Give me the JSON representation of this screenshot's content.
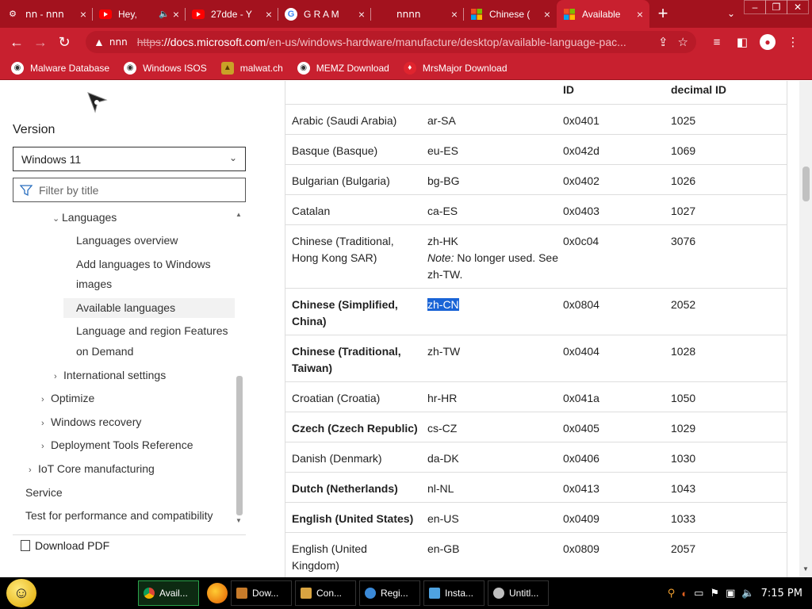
{
  "browser": {
    "tabs": [
      {
        "title": "𝗇𝗇 - 𝗇𝗇𝗇",
        "icon": "gear-icon"
      },
      {
        "title": "Hey,",
        "icon": "youtube-icon"
      },
      {
        "title": "27dde - Y",
        "icon": "youtube-icon"
      },
      {
        "title": "G R A M",
        "icon": "google-icon"
      },
      {
        "title": "𝗇𝗇𝗇𝗇",
        "icon": "blank-icon"
      },
      {
        "title": "Chinese (",
        "icon": "microsoft-icon"
      },
      {
        "title": "Available",
        "icon": "microsoft-icon"
      }
    ],
    "new_tab": "+",
    "address": {
      "site_label": "𝗇𝗇𝗇",
      "protocol": "https",
      "host": "://docs.microsoft.com",
      "path": "/en-us/windows-hardware/manufacture/desktop/available-language-pac..."
    },
    "bookmarks": [
      {
        "label": "Malware Database"
      },
      {
        "label": "Windows ISOS"
      },
      {
        "label": "malwat.ch"
      },
      {
        "label": "MEMZ Download"
      },
      {
        "label": "MrsMajor Download"
      }
    ],
    "colors": {
      "chrome": "#c8202f",
      "tabstrip": "#a3121e"
    }
  },
  "sidebar": {
    "version_label": "Version",
    "version_value": "Windows 11",
    "filter_placeholder": "Filter by title",
    "toc": [
      {
        "label": "Languages"
      },
      {
        "label": "Languages overview"
      },
      {
        "label": "Add languages to Windows"
      },
      {
        "label": "images"
      },
      {
        "label": "Available languages"
      },
      {
        "label": "Language and region Features"
      },
      {
        "label": "on Demand"
      },
      {
        "label": "International settings"
      },
      {
        "label": "Optimize"
      },
      {
        "label": "Windows recovery"
      },
      {
        "label": "Deployment Tools Reference"
      },
      {
        "label": "IoT Core manufacturing"
      },
      {
        "label": "Service"
      },
      {
        "label": "Test for performance and compatibility"
      }
    ],
    "download_pdf": "Download PDF"
  },
  "table": {
    "headers": {
      "id": "ID",
      "decimal": "decimal ID"
    },
    "rows": [
      {
        "lang": "Arabic (Saudi Arabia)",
        "tag": "ar-SA",
        "id": "0x0401",
        "dec": "1025"
      },
      {
        "lang": "Basque (Basque)",
        "tag": "eu-ES",
        "id": "0x042d",
        "dec": "1069"
      },
      {
        "lang": "Bulgarian (Bulgaria)",
        "tag": "bg-BG",
        "id": "0x0402",
        "dec": "1026"
      },
      {
        "lang": "Catalan",
        "tag": "ca-ES",
        "id": "0x0403",
        "dec": "1027"
      },
      {
        "lang": "Chinese (Traditional, Hong Kong SAR)",
        "tag": "zh-HK",
        "note_label": "Note:",
        "note": " No longer used. See zh-TW.",
        "id": "0x0c04",
        "dec": "3076"
      },
      {
        "lang": "Chinese (Simplified, China)",
        "tag": "zh-CN",
        "id": "0x0804",
        "dec": "2052"
      },
      {
        "lang": "Chinese (Traditional, Taiwan)",
        "tag": "zh-TW",
        "id": "0x0404",
        "dec": "1028"
      },
      {
        "lang": "Croatian (Croatia)",
        "tag": "hr-HR",
        "id": "0x041a",
        "dec": "1050"
      },
      {
        "lang": "Czech (Czech Republic)",
        "tag": "cs-CZ",
        "id": "0x0405",
        "dec": "1029"
      },
      {
        "lang": "Danish (Denmark)",
        "tag": "da-DK",
        "id": "0x0406",
        "dec": "1030"
      },
      {
        "lang": "Dutch (Netherlands)",
        "tag": "nl-NL",
        "id": "0x0413",
        "dec": "1043"
      },
      {
        "lang": "English (United States)",
        "tag": "en-US",
        "id": "0x0409",
        "dec": "1033"
      },
      {
        "lang": "English (United Kingdom)",
        "tag": "en-GB",
        "id": "0x0809",
        "dec": "2057"
      }
    ]
  },
  "taskbar": {
    "tasks": [
      {
        "label": "Avail..."
      },
      {
        "label": "Dow..."
      },
      {
        "label": "Con..."
      },
      {
        "label": "Regi..."
      },
      {
        "label": "Insta..."
      },
      {
        "label": "Untitl..."
      }
    ],
    "clock": "7:15 PM"
  }
}
